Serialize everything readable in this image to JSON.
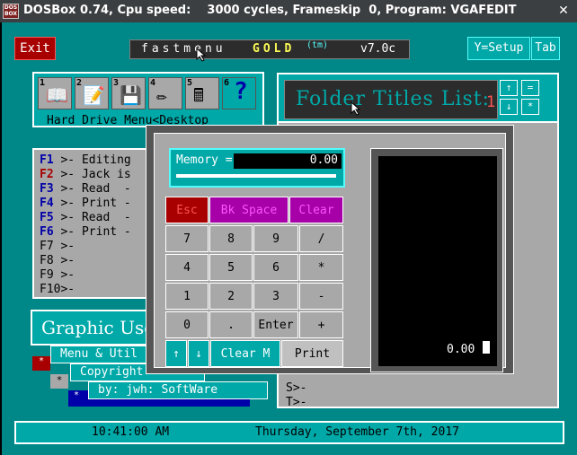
{
  "window": {
    "logo_text": "DOS BOX",
    "title": "DOSBox 0.74, Cpu speed:    3000 cycles, Frameskip  0, Program: VGAFEDIT",
    "close_label": "✕"
  },
  "topbar": {
    "exit_label": "Exit",
    "banner_name": "fastmenu",
    "banner_gold": "GOLD",
    "banner_tm": "(tm)",
    "banner_version": "v7.0c",
    "setup_label": "Y=Setup",
    "tab_label": "Tab"
  },
  "icon_panel": {
    "icons": [
      {
        "num": "1",
        "icon": "book-icon",
        "glyph": "📖"
      },
      {
        "num": "2",
        "icon": "document-edit-icon",
        "glyph": "📝"
      },
      {
        "num": "3",
        "icon": "floppy-icon",
        "glyph": "💾"
      },
      {
        "num": "4",
        "icon": "pencil-icon",
        "glyph": "✏"
      },
      {
        "num": "5",
        "icon": "calculator-icon",
        "glyph": "🖩"
      },
      {
        "num": "6",
        "icon": "help-icon",
        "glyph": "?"
      }
    ],
    "caption": "Hard Drive Menu<Desktop"
  },
  "folder_header": {
    "title": "Folder Titles List:",
    "number": "1",
    "up_label": "↑",
    "down_label": "↓",
    "eq_label": "=",
    "star_label": "*"
  },
  "fkeys": [
    {
      "key": "F1",
      "text": ">- Editing",
      "style": "k"
    },
    {
      "key": "F2",
      "text": ">- Jack is",
      "style": "kr"
    },
    {
      "key": "F3",
      "text": ">- Read  -",
      "style": "k"
    },
    {
      "key": "F4",
      "text": ">- Print -",
      "style": "k"
    },
    {
      "key": "F5",
      "text": ">- Read  -",
      "style": "k"
    },
    {
      "key": "F6",
      "text": ">- Print -",
      "style": "k"
    },
    {
      "key": "F7",
      "text": ">-",
      "style": ""
    },
    {
      "key": "F8",
      "text": ">-",
      "style": ""
    },
    {
      "key": "F9",
      "text": ">-",
      "style": ""
    },
    {
      "key": "F10",
      "text": ">-",
      "style": ""
    }
  ],
  "right_list": {
    "rows": [
      "S>-",
      "T>-"
    ]
  },
  "lower_windows": {
    "gui_title": "Graphic User I",
    "menu_util": "Menu &  Util",
    "red_marker": "*",
    "copyright": "Copyright",
    "star_marker": "*",
    "byline": "by:  jwh: SoftWare",
    "blue_marker": "*"
  },
  "calculator": {
    "memory_label": "Memory =",
    "memory_value": "0.00",
    "display_value": "0.00",
    "buttons": {
      "esc": "Esc",
      "bkspace": "Bk Space",
      "clear": "Clear",
      "b7": "7",
      "b8": "8",
      "b9": "9",
      "div": "/",
      "b4": "4",
      "b5": "5",
      "b6": "6",
      "mul": "*",
      "b1": "1",
      "b2": "2",
      "b3": "3",
      "sub": "-",
      "b0": "0",
      "dot": ".",
      "enter": "Enter",
      "add": "+",
      "up": "↑",
      "down": "↓",
      "clearm": "Clear M",
      "print": "Print"
    }
  },
  "statusbar": {
    "time": "10:41:00 AM",
    "date": "Thursday, September 7th, 2017"
  }
}
